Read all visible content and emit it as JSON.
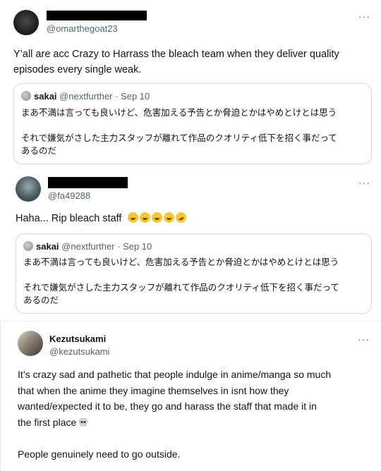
{
  "tweet1": {
    "handle": "@omarthegoat23",
    "more": "···",
    "text_line1": "Y’all are acc Crazy to Harrass the bleach team when they deliver quality",
    "text_line2": "episodes every single weak.",
    "quote": {
      "name": "sakai",
      "handle_date": "@nextfurther · Sep 10",
      "line1": "まあ不満は言っても良いけど、危害加える予告とか脅迫とかはやめとけとは思う",
      "line2": "それで嫌気がさした主力スタッフが離れて作品のクオリティ低下を招く事だって",
      "line3": "あるのだ"
    }
  },
  "tweet2": {
    "handle": "@fa49288",
    "more": "···",
    "text": "Haha... Rip bleach staff",
    "emojis": [
      "joy",
      "joy",
      "joy",
      "joy",
      "rofl"
    ],
    "quote": {
      "name": "sakai",
      "handle_date": "@nextfurther · Sep 10",
      "line1": "まあ不満は言っても良いけど、危害加える予告とか脅迫とかはやめとけとは思う",
      "line2": "それで嫌気がさした主力スタッフが離れて作品のクオリティ低下を招く事だって",
      "line3": "あるのだ"
    }
  },
  "tweet3": {
    "name": "Kezutsukami",
    "handle": "@kezutsukami",
    "more": "···",
    "line1": "It’s crazy sad and pathetic that people indulge in anime/manga so much",
    "line2": "that when the anime they imagine themselves in isnt how they",
    "line3": "wanted/expected it to be, they go and harass the staff that made it in",
    "line4": "the first place",
    "line5": "People genuinely need to go outside."
  }
}
